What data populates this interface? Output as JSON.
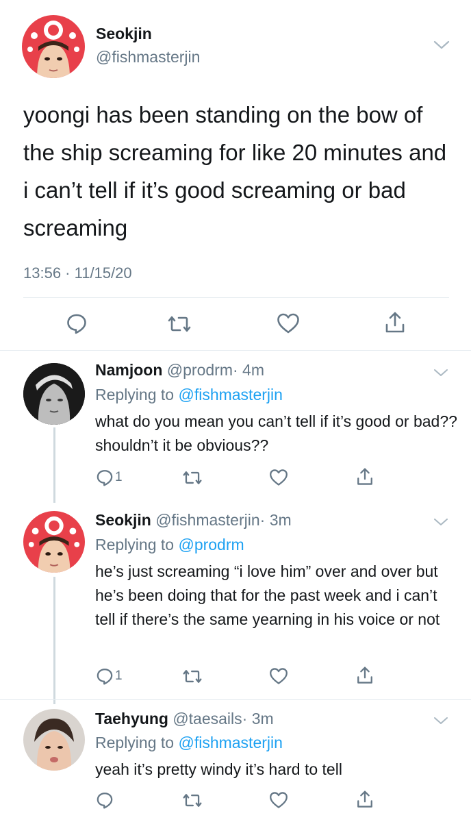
{
  "main_tweet": {
    "display_name": "Seokjin",
    "handle": "@fishmasterjin",
    "text": "yoongi has been standing on the bow of the ship screaming for like 20 minutes and i can’t tell if it’s good screaming or bad screaming",
    "timestamp": "13:56 · 11/15/20",
    "actions": {
      "reply_icon": "reply-icon",
      "retweet_icon": "retweet-icon",
      "like_icon": "heart-icon",
      "share_icon": "share-icon"
    }
  },
  "replies": [
    {
      "display_name": "Namjoon",
      "handle": "@prodrm",
      "time": "· 4m",
      "replying_prefix": "Replying to ",
      "replying_to": "@fishmasterjin",
      "text": "what do you mean you can’t tell if it’s good or bad?? shouldn’t it be obvious??",
      "reply_count": "1"
    },
    {
      "display_name": "Seokjin",
      "handle": "@fishmasterjin",
      "time": "· 3m",
      "replying_prefix": "Replying to ",
      "replying_to": "@prodrm",
      "text": "he’s just screaming “i love him” over and over but he’s been doing that for the past week and i can’t tell if there’s the same yearning in his voice or not",
      "reply_count": "1"
    },
    {
      "display_name": "Taehyung",
      "handle": "@taesails",
      "time": "· 3m",
      "replying_prefix": "Replying to ",
      "replying_to": "@fishmasterjin",
      "text": "yeah it’s pretty windy it’s hard to tell",
      "reply_count": ""
    }
  ],
  "colors": {
    "text": "#14171a",
    "secondary": "#657786",
    "link": "#1da1f2",
    "divider": "#e6ecf0"
  }
}
